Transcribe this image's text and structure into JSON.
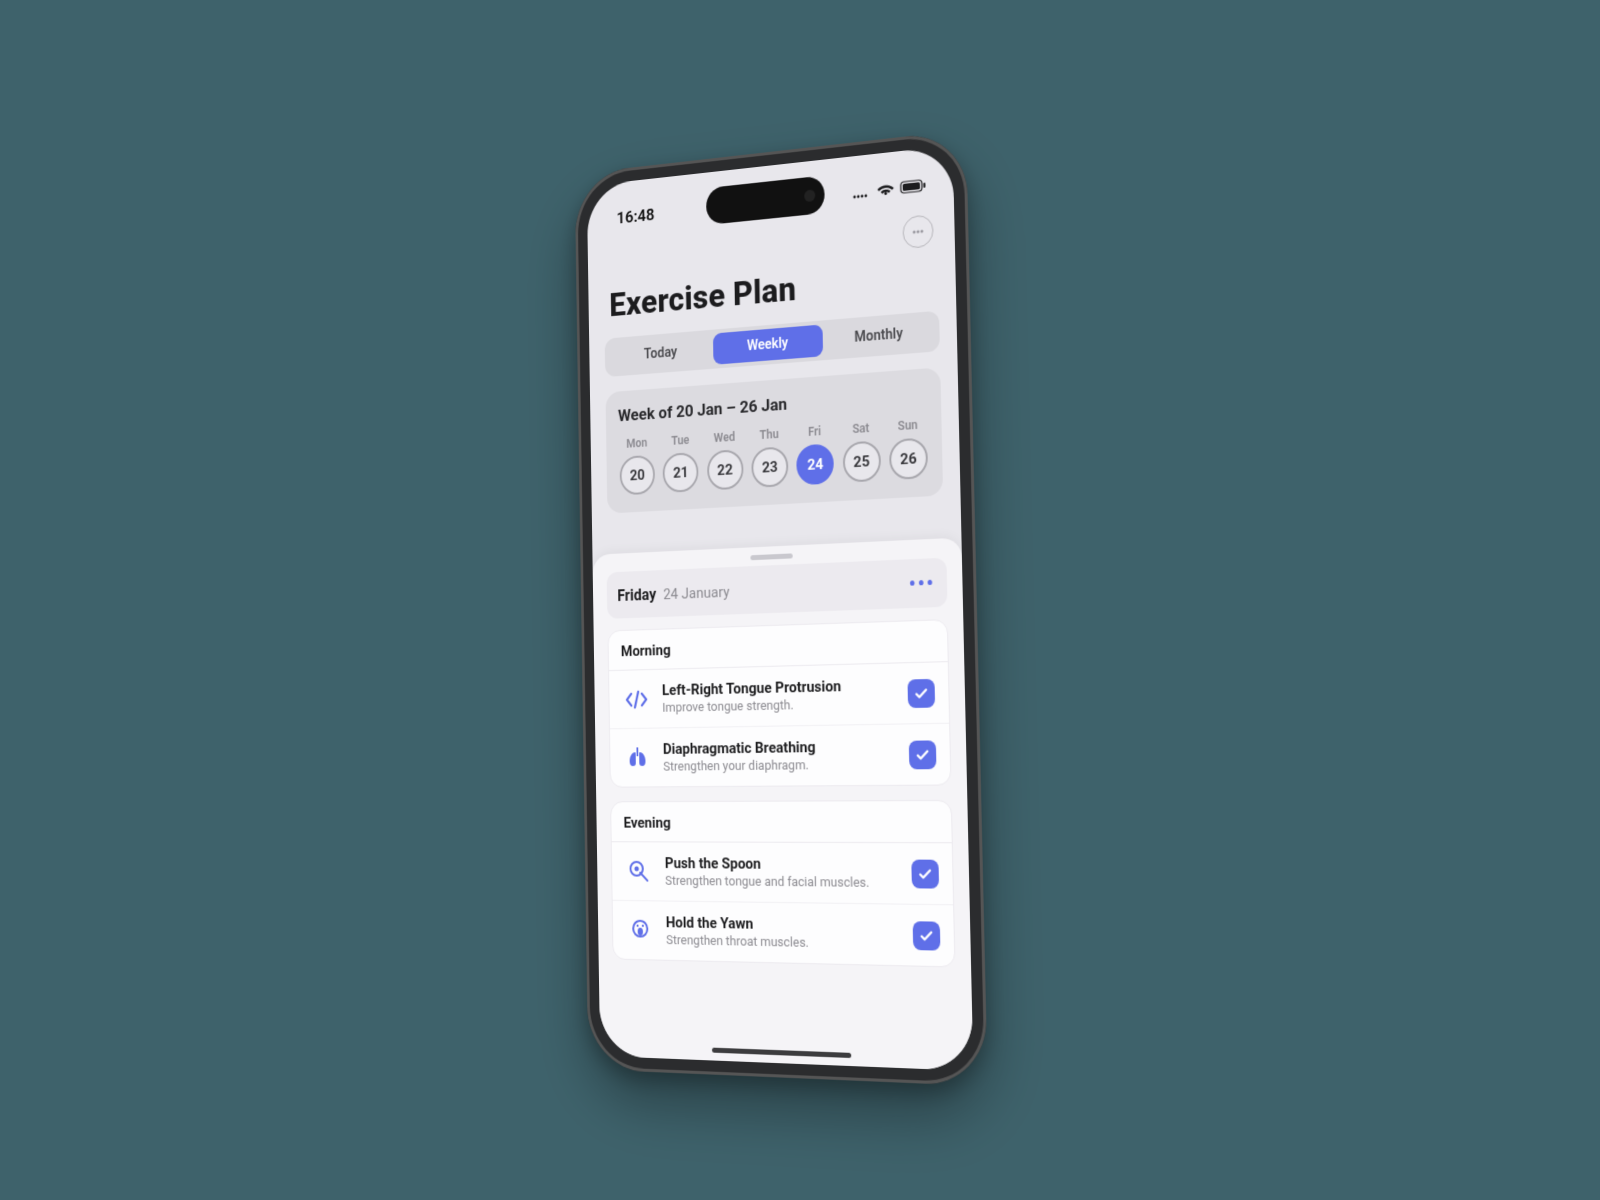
{
  "status": {
    "time": "16:48"
  },
  "page_title": "Exercise Plan",
  "segmented": {
    "today": "Today",
    "weekly": "Weekly",
    "monthly": "Monthly",
    "active": "weekly"
  },
  "week": {
    "title": "Week of 20 Jan  – 26 Jan",
    "days": [
      {
        "name": "Mon",
        "num": "20"
      },
      {
        "name": "Tue",
        "num": "21"
      },
      {
        "name": "Wed",
        "num": "22"
      },
      {
        "name": "Thu",
        "num": "23"
      },
      {
        "name": "Fri",
        "num": "24",
        "selected": true
      },
      {
        "name": "Sat",
        "num": "25"
      },
      {
        "name": "Sun",
        "num": "26"
      }
    ]
  },
  "sheet": {
    "weekday": "Friday",
    "date": "24 January",
    "sections": [
      {
        "title": "Morning",
        "items": [
          {
            "icon": "tongue-lr-icon",
            "title": "Left-Right Tongue Protrusion",
            "subtitle": "Improve tongue strength.",
            "checked": true
          },
          {
            "icon": "lungs-icon",
            "title": "Diaphragmatic Breathing",
            "subtitle": "Strengthen your diaphragm.",
            "checked": true
          }
        ]
      },
      {
        "title": "Evening",
        "items": [
          {
            "icon": "spoon-icon",
            "title": "Push the Spoon",
            "subtitle": "Strengthen tongue and facial muscles.",
            "checked": true
          },
          {
            "icon": "yawn-icon",
            "title": "Hold the Yawn",
            "subtitle": "Strengthen throat muscles.",
            "checked": true
          }
        ]
      }
    ]
  }
}
